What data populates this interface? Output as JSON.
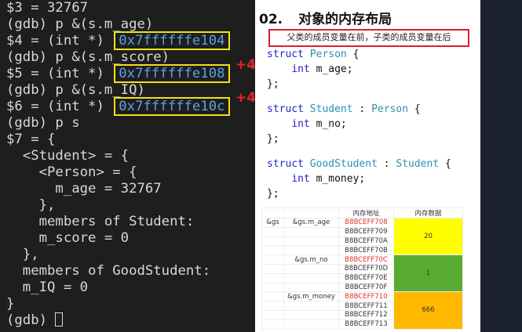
{
  "terminal": {
    "lines": [
      "$3 = 32767",
      "(gdb) p &(s.m_age)",
      "$4 = (int *) ",
      "(gdb) p &(s.m_score)",
      "$5 = (int *) ",
      "(gdb) p &(s.m_IQ)",
      "$6 = (int *) ",
      "(gdb) p s",
      "$7 = {",
      "  <Student> = {",
      "    <Person> = {",
      "      m_age = 32767",
      "    },",
      "    members of Student:",
      "    m_score = 0",
      "  },",
      "  members of GoodStudent:",
      "  m_IQ = 0",
      "}",
      "(gdb) "
    ],
    "addresses": [
      "0x7ffffffe104",
      "0x7ffffffe108",
      "0x7ffffffe10c"
    ],
    "offsets": [
      "+4",
      "+4"
    ]
  },
  "slide": {
    "number": "02.",
    "title": "对象的内存布局",
    "note": "父类的成员变量在前，子类的成员变量在后",
    "code": [
      {
        "kw": "struct",
        "name": "Person",
        "base": "",
        "field": "m_age;"
      },
      {
        "kw": "struct",
        "name": "Student",
        "base": "Person",
        "field": "m_no;"
      },
      {
        "kw": "struct",
        "name": "GoodStudent",
        "base": "Student",
        "field": "m_money;"
      }
    ],
    "int_kw": "int",
    "table": {
      "headers": [
        "内存地址",
        "内存数据"
      ],
      "var": "&gs",
      "fields": [
        {
          "name": "&gs.m_age",
          "addrs": [
            "B8BCEFF708",
            "B8BCEFF709",
            "B8BCEFF70A",
            "B8BCEFF70B"
          ],
          "value": "20",
          "color": "#ffff00"
        },
        {
          "name": "&gs.m_no",
          "addrs": [
            "B8BCEFF70C",
            "B8BCEFF70D",
            "B8BCEFF70E",
            "B8BCEFF70F"
          ],
          "value": "1",
          "color": "#5aab32"
        },
        {
          "name": "&gs.m_money",
          "addrs": [
            "B8BCEFF710",
            "B8BCEFF711",
            "B8BCEFF712",
            "B8BCEFF713"
          ],
          "value": "666",
          "color": "#ffb800"
        }
      ]
    }
  }
}
